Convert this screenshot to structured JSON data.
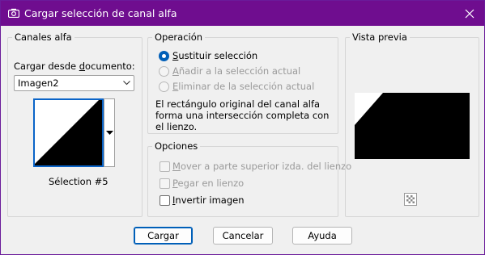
{
  "window": {
    "title": "Cargar selección de canal alfa",
    "title_icon": "camera-icon",
    "close_icon": "close-icon",
    "accent_color": "#6f0d8f"
  },
  "canales": {
    "legend": "Canales alfa",
    "source_label": "Cargar desde documento:",
    "document_value": "Imagen2",
    "channel_name": "Sélection #5"
  },
  "operacion": {
    "legend": "Operación",
    "options": [
      {
        "label": "Sustituir selección",
        "selected": true,
        "enabled": true
      },
      {
        "label": "Añadir a la selección actual",
        "selected": false,
        "enabled": false
      },
      {
        "label": "Eliminar de la selección actual",
        "selected": false,
        "enabled": false
      }
    ],
    "description": [
      "El rectángulo original del canal alfa",
      "forma una intersección completa con",
      "el lienzo."
    ]
  },
  "opciones": {
    "legend": "Opciones",
    "items": [
      {
        "label": "Mover a parte superior izda. del lienzo",
        "checked": false,
        "enabled": false
      },
      {
        "label": "Pegar en lienzo",
        "checked": false,
        "enabled": false
      },
      {
        "label": "Invertir imagen",
        "checked": false,
        "enabled": true
      }
    ]
  },
  "vista_previa": {
    "legend": "Vista previa",
    "zoom_icon": "checkerboard-icon"
  },
  "buttons": {
    "ok": "Cargar",
    "cancel": "Cancelar",
    "help": "Ayuda"
  }
}
